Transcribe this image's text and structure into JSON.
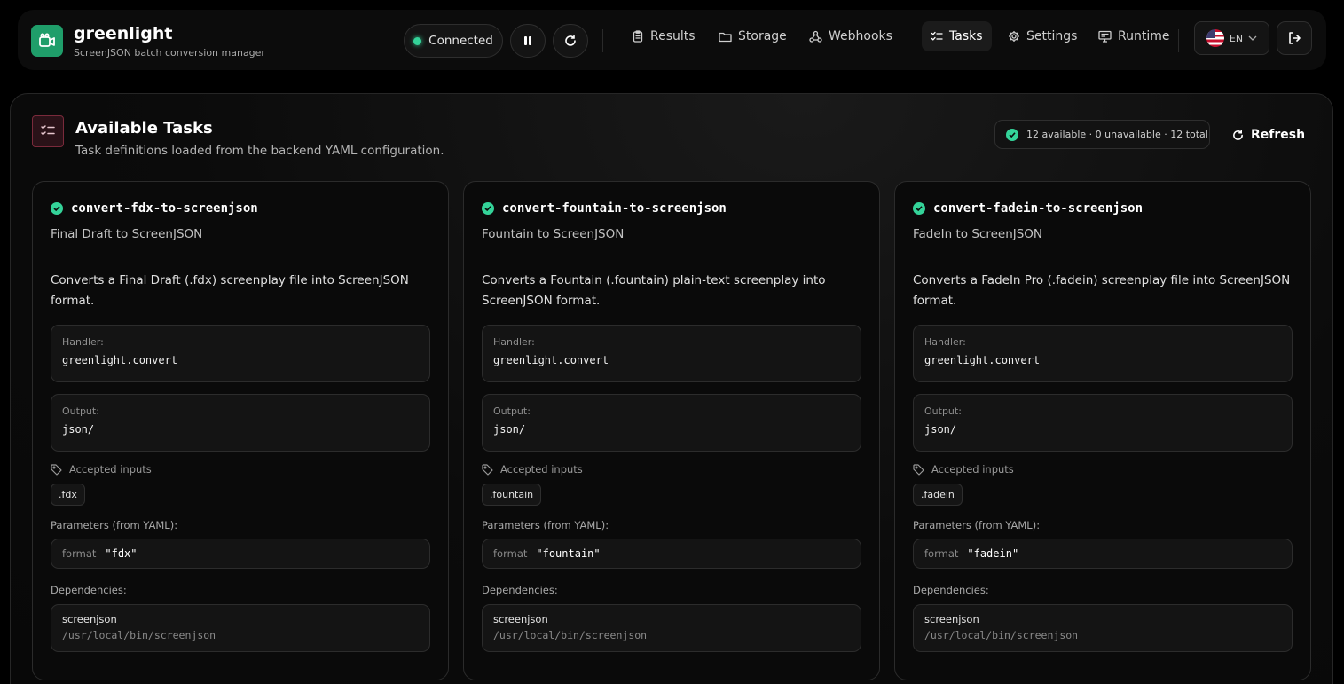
{
  "app": {
    "title": "greenlight",
    "subtitle": "ScreenJSON batch conversion manager",
    "logo_icon": "camera-icon",
    "accent": "#1f9e6a"
  },
  "header": {
    "status_label": "Connected",
    "status_color": "#34d399",
    "nav": [
      {
        "label": "Results",
        "icon": "clipboard-icon"
      },
      {
        "label": "Storage",
        "icon": "folder-icon"
      },
      {
        "label": "Webhooks",
        "icon": "webhook-icon"
      },
      {
        "label": "Tasks",
        "icon": "tasks-icon",
        "active": true
      },
      {
        "label": "Settings",
        "icon": "gear-icon"
      },
      {
        "label": "Runtime",
        "icon": "monitor-icon"
      }
    ],
    "language": "EN"
  },
  "panel": {
    "title": "Available Tasks",
    "subtitle": "Task definitions loaded from the backend YAML configuration.",
    "summary": "12 available · 0 unavailable · 12 total",
    "refresh_label": "Refresh"
  },
  "labels": {
    "handler": "Handler:",
    "output": "Output:",
    "accepted_inputs": "Accepted inputs",
    "parameters": "Parameters (from YAML):",
    "dependencies": "Dependencies:"
  },
  "tasks": [
    {
      "id": "convert-fdx-to-screenjson",
      "name": "Final Draft to ScreenJSON",
      "description": "Converts a Final Draft (.fdx) screenplay file into ScreenJSON format.",
      "handler": "greenlight.convert",
      "output": "json/",
      "inputs": ".fdx",
      "param_key": "format",
      "param_value": "\"fdx\"",
      "dep_name": "screenjson",
      "dep_path": "/usr/local/bin/screenjson"
    },
    {
      "id": "convert-fountain-to-screenjson",
      "name": "Fountain to ScreenJSON",
      "description": "Converts a Fountain (.fountain) plain-text screenplay into ScreenJSON format.",
      "handler": "greenlight.convert",
      "output": "json/",
      "inputs": ".fountain",
      "param_key": "format",
      "param_value": "\"fountain\"",
      "dep_name": "screenjson",
      "dep_path": "/usr/local/bin/screenjson"
    },
    {
      "id": "convert-fadein-to-screenjson",
      "name": "FadeIn to ScreenJSON",
      "description": "Converts a FadeIn Pro (.fadein) screenplay file into ScreenJSON format.",
      "handler": "greenlight.convert",
      "output": "json/",
      "inputs": ".fadein",
      "param_key": "format",
      "param_value": "\"fadein\"",
      "dep_name": "screenjson",
      "dep_path": "/usr/local/bin/screenjson"
    }
  ]
}
